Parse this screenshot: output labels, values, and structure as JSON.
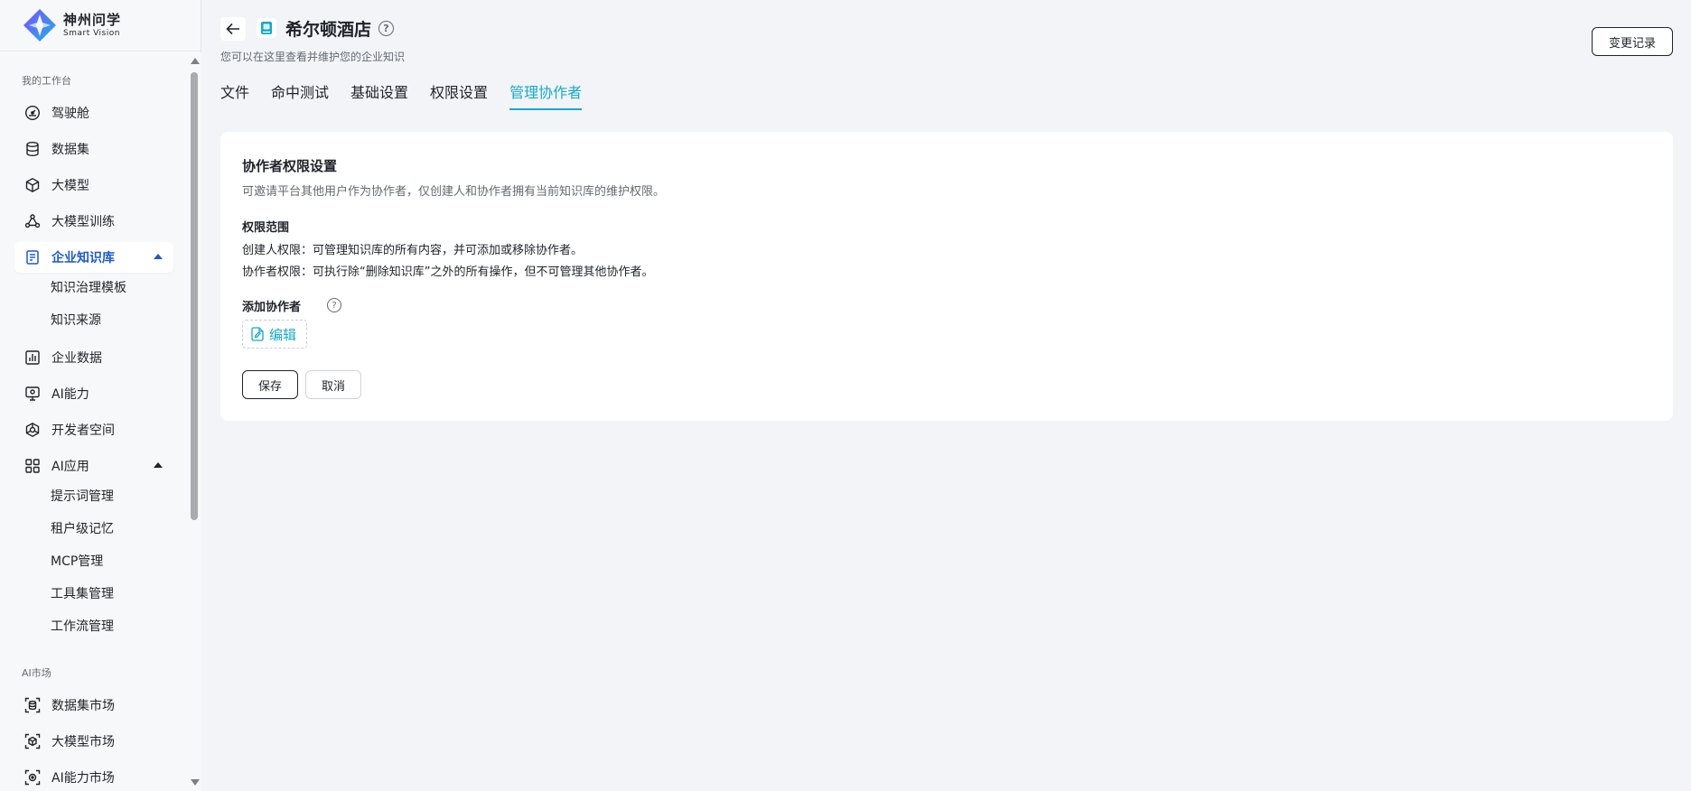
{
  "logo": {
    "name_cn": "神州问学",
    "name_en": "Smart Vision"
  },
  "sidebar": {
    "section_workbench": "我的工作台",
    "items": [
      {
        "label": "驾驶舱",
        "icon": "gauge-icon"
      },
      {
        "label": "数据集",
        "icon": "database-icon"
      },
      {
        "label": "大模型",
        "icon": "cube-icon"
      },
      {
        "label": "大模型训练",
        "icon": "network-icon"
      },
      {
        "label": "企业知识库",
        "icon": "book-icon",
        "active": true,
        "expanded": true
      },
      {
        "label": "企业数据",
        "icon": "bar-chart-icon"
      },
      {
        "label": "AI能力",
        "icon": "monitor-icon"
      },
      {
        "label": "开发者空间",
        "icon": "hexagon-icon"
      },
      {
        "label": "AI应用",
        "icon": "grid-icon",
        "expanded": true
      }
    ],
    "kb_sub": [
      "知识治理模板",
      "知识来源"
    ],
    "ai_app_sub": [
      "提示词管理",
      "租户级记忆",
      "MCP管理",
      "工具集管理",
      "工作流管理"
    ],
    "section_market": "AI市场",
    "market_items": [
      {
        "label": "数据集市场",
        "icon": "scan-database-icon"
      },
      {
        "label": "大模型市场",
        "icon": "scan-cube-icon"
      },
      {
        "label": "AI能力市场",
        "icon": "scan-ai-icon"
      }
    ]
  },
  "header": {
    "title": "希尔顿酒店",
    "subtitle": "您可以在这里查看并维护您的企业知识",
    "changelog_label": "变更记录"
  },
  "tabs": [
    {
      "label": "文件"
    },
    {
      "label": "命中测试"
    },
    {
      "label": "基础设置"
    },
    {
      "label": "权限设置"
    },
    {
      "label": "管理协作者",
      "active": true
    }
  ],
  "card": {
    "title": "协作者权限设置",
    "desc": "可邀请平台其他用户作为协作者，仅创建人和协作者拥有当前知识库的维护权限。",
    "scope_title": "权限范围",
    "scope_creator": "创建人权限：可管理知识库的所有内容，并可添加或移除协作者。",
    "scope_collab": "协作者权限：可执行除“删除知识库”之外的所有操作，但不可管理其他协作者。",
    "add_label": "添加协作者",
    "edit_label": "编辑",
    "save_label": "保存",
    "cancel_label": "取消"
  },
  "colors": {
    "accent": "#17a9c9",
    "active_nav": "#1e5bc6"
  }
}
